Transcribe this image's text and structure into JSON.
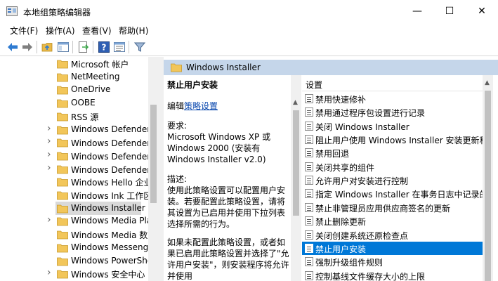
{
  "window": {
    "title": "本地组策略编辑器",
    "minimize_glyph": "—",
    "maximize_glyph": "☐",
    "close_glyph": "✕"
  },
  "menu": [
    "文件(F)",
    "操作(A)",
    "查看(V)",
    "帮助(H)"
  ],
  "tree": {
    "items": [
      {
        "label": "Microsoft 帐户",
        "expandable": false
      },
      {
        "label": "NetMeeting",
        "expandable": false
      },
      {
        "label": "OneDrive",
        "expandable": false
      },
      {
        "label": "OOBE",
        "expandable": false
      },
      {
        "label": "RSS 源",
        "expandable": false
      },
      {
        "label": "Windows Defender S",
        "expandable": true
      },
      {
        "label": "Windows Defender 防",
        "expandable": true
      },
      {
        "label": "Windows Defender 攻",
        "expandable": true
      },
      {
        "label": "Windows Defender 应",
        "expandable": true
      },
      {
        "label": "Windows Hello 企业版",
        "expandable": false
      },
      {
        "label": "Windows Ink 工作区",
        "expandable": false
      },
      {
        "label": "Windows Installer",
        "expandable": false,
        "selected": true
      },
      {
        "label": "Windows Media Play",
        "expandable": true
      },
      {
        "label": "Windows Media 数字",
        "expandable": false
      },
      {
        "label": "Windows Messenger",
        "expandable": false
      },
      {
        "label": "Windows PowerShell",
        "expandable": false
      },
      {
        "label": "Windows 安全中心",
        "expandable": true
      }
    ]
  },
  "header": {
    "title": "Windows Installer"
  },
  "description": {
    "policy_title": "禁止用户安装",
    "edit_prefix": "编辑",
    "edit_link": "策略设置",
    "requirements_label": "要求:",
    "requirements_text": "Microsoft Windows XP 或 Windows 2000 (安装有 Windows Installer v2.0)",
    "description_label": "描述:",
    "description_text": "使用此策略设置可以配置用户安装。若要配置此策略设置，请将其设置为已启用并使用下拉列表选择所需的行为。",
    "more_text": "如果未配置此策略设置，或者如果已启用此策略设置并选择了\"允许用户安装\"，则安装程序将允许并使用"
  },
  "settings": {
    "header": "设置",
    "items": [
      {
        "label": "禁用快速修补"
      },
      {
        "label": "禁用通过程序包设置进行记录"
      },
      {
        "label": "关闭 Windows Installer"
      },
      {
        "label": "阻止用户使用 Windows Installer 安装更新和升"
      },
      {
        "label": "禁用回退"
      },
      {
        "label": "关闭共享的组件"
      },
      {
        "label": "允许用户对安装进行控制"
      },
      {
        "label": "指定 Windows Installer 在事务日志中记录的事"
      },
      {
        "label": "禁止非管理员应用供应商签名的更新"
      },
      {
        "label": "禁止删除更新"
      },
      {
        "label": "关闭创建系统还原检查点"
      },
      {
        "label": "禁止用户安装",
        "selected": true
      },
      {
        "label": "强制升级组件规则"
      },
      {
        "label": "控制基线文件缓存大小的上限"
      }
    ]
  },
  "colors": {
    "selection": "#0078d7",
    "header_band": "#c5d6ea",
    "link": "#0645ad"
  }
}
